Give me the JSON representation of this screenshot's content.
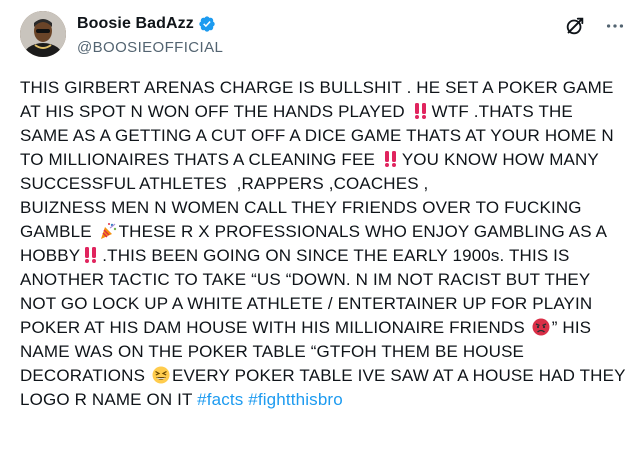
{
  "author": {
    "display_name": "Boosie BadAzz",
    "handle": "@BOOSIEOFFICIAL",
    "verified": true
  },
  "icons": {
    "verified": "verified-badge-icon",
    "grok": "grok-icon",
    "more": "more-options-icon"
  },
  "colors": {
    "text": "#0f1419",
    "secondary": "#536471",
    "link": "#1d9bf0",
    "verified": "#1d9bf0"
  },
  "post": {
    "seg1": "THIS GIRBERT ARENAS CHARGE IS BULLSHIT . HE SET A POKER GAME AT HIS SPOT N WON OFF THE HANDS PLAYED ",
    "seg2": "WTF .THATS THE SAME AS A GETTING A CUT OFF A DICE GAME THATS AT YOUR HOME N TO MILLIONAIRES THATS A CLEANING FEE ",
    "seg3": "YOU KNOW HOW MANY SUCCESSFUL ATHLETES  ,RAPPERS ,COACHES ,\nBUIZNESS MEN N WOMEN CALL THEY FRIENDS OVER TO FUCKING GAMBLE ",
    "seg4": "THESE R X PROFESSIONALS WHO ENJOY GAMBLING AS A HOBBY",
    "seg5": ".THIS BEEN GOING ON SINCE THE EARLY 1900s. THIS IS ANOTHER TACTIC TO TAKE “US “DOWN. N IM NOT RACIST BUT THEY NOT GO LOCK UP A WHITE ATHLETE / ENTERTAINER UP FOR PLAYIN POKER AT HIS DAM HOUSE WITH HIS MILLIONAIRE FRIENDS ",
    "seg6": "” HIS NAME WAS ON THE POKER TABLE “GTFOH THEM BE HOUSE DECORATIONS ",
    "seg7": "EVERY POKER TABLE IVE SAW AT A HOUSE HAD THEY LOGO R NAME ON IT ",
    "hashtag1": "#facts",
    "hashtag2": "#fightthisbro",
    "emojis": [
      "double-exclamation-emoji",
      "double-exclamation-emoji",
      "party-popper-emoji",
      "double-exclamation-emoji",
      "angry-face-emoji",
      "grinning-squinting-face-emoji"
    ]
  }
}
